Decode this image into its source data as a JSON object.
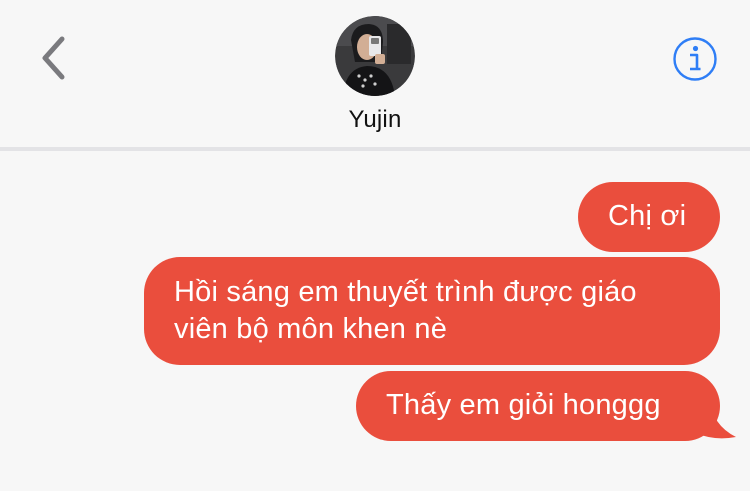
{
  "header": {
    "contact_name": "Yujin",
    "back_icon": "chevron-left-icon",
    "info_icon": "info-circle-icon",
    "accent_color": "#2f7ef6"
  },
  "messages": [
    {
      "sender": "me",
      "text": "Chị ơi"
    },
    {
      "sender": "me",
      "text": "Hồi sáng em thuyết trình được giáo viên bộ môn khen nè"
    },
    {
      "sender": "me",
      "text": "Thấy em giỏi honggg"
    }
  ],
  "colors": {
    "bubble": "#ea4e3d",
    "bubble_text": "#ffffff",
    "background": "#f7f7f7"
  }
}
